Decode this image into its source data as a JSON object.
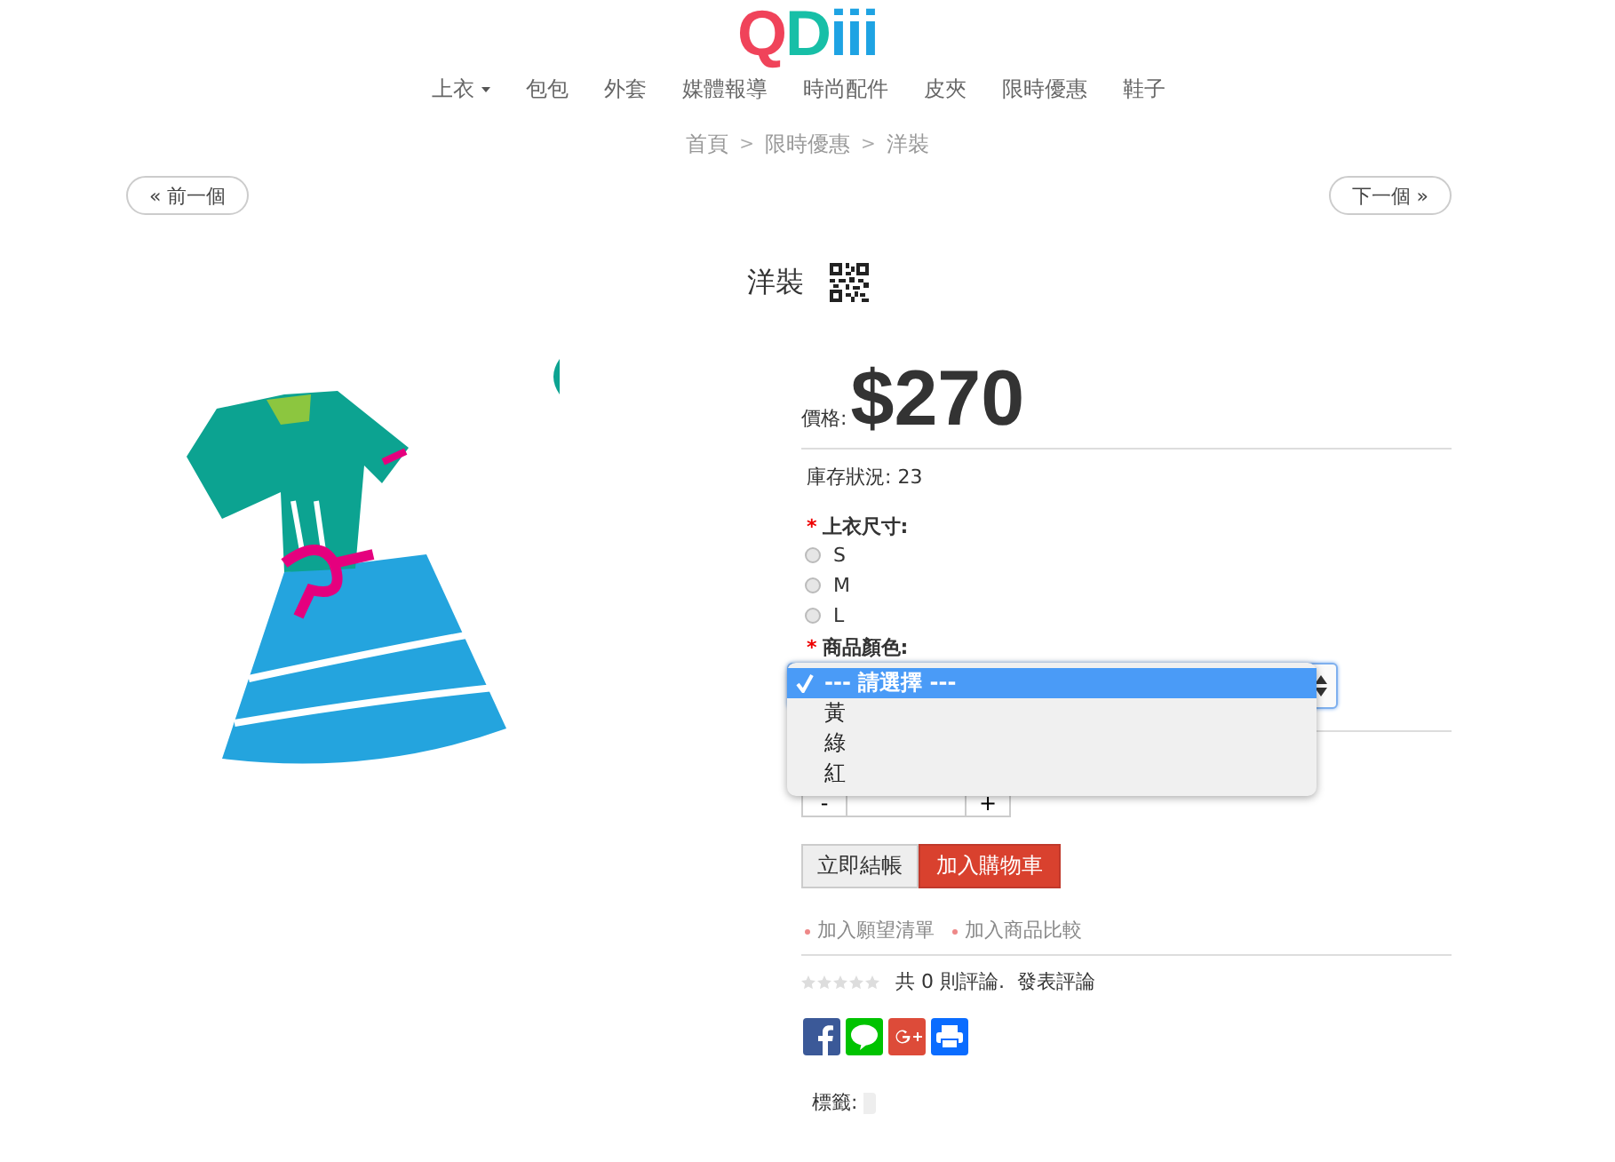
{
  "logo": [
    {
      "text": "Q",
      "color": "#f0435a"
    },
    {
      "text": "D",
      "color": "#17bfa7"
    },
    {
      "text": "iii",
      "color": "#1ea3e3"
    }
  ],
  "nav": [
    {
      "label": "上衣",
      "dropdown": true
    },
    {
      "label": "包包",
      "dropdown": false
    },
    {
      "label": "外套",
      "dropdown": false
    },
    {
      "label": "媒體報導",
      "dropdown": false
    },
    {
      "label": "時尚配件",
      "dropdown": false
    },
    {
      "label": "皮夾",
      "dropdown": false
    },
    {
      "label": "限時優惠",
      "dropdown": false
    },
    {
      "label": "鞋子",
      "dropdown": false
    }
  ],
  "breadcrumb": [
    "首頁",
    "限時優惠",
    "洋裝"
  ],
  "breadcrumb_separator": ">",
  "prev_button": "« 前一個",
  "next_button": "下一個 »",
  "product": {
    "title": "洋裝",
    "image": {
      "kind": "picture"
    },
    "price_label": "價格:",
    "price": "$270",
    "stock": "庫存狀況: 23",
    "options": [
      {
        "kind": "radio",
        "required_mark": "*",
        "label": "上衣尺寸:",
        "choices": [
          {
            "label": "S",
            "selected": false
          },
          {
            "label": "M",
            "selected": false
          },
          {
            "label": "L",
            "selected": false
          }
        ]
      },
      {
        "kind": "select",
        "required_mark": "*",
        "label": "商品顏色:",
        "expanded": true,
        "choices": [
          {
            "label": "--- 請選擇 ---",
            "selected": true
          },
          {
            "label": "黃",
            "selected": false
          },
          {
            "label": "綠",
            "selected": false
          },
          {
            "label": "紅",
            "selected": false
          }
        ]
      }
    ],
    "quantity": {
      "minus": "-",
      "plus": "+"
    },
    "buy_now": "立即結帳",
    "add_to_cart": "加入購物車",
    "links": [
      "加入願望清單",
      "加入商品比較"
    ],
    "stars": 0,
    "review_count": "共 0 則評論.",
    "write_review": "發表評論",
    "tags_label": "標籤:"
  }
}
